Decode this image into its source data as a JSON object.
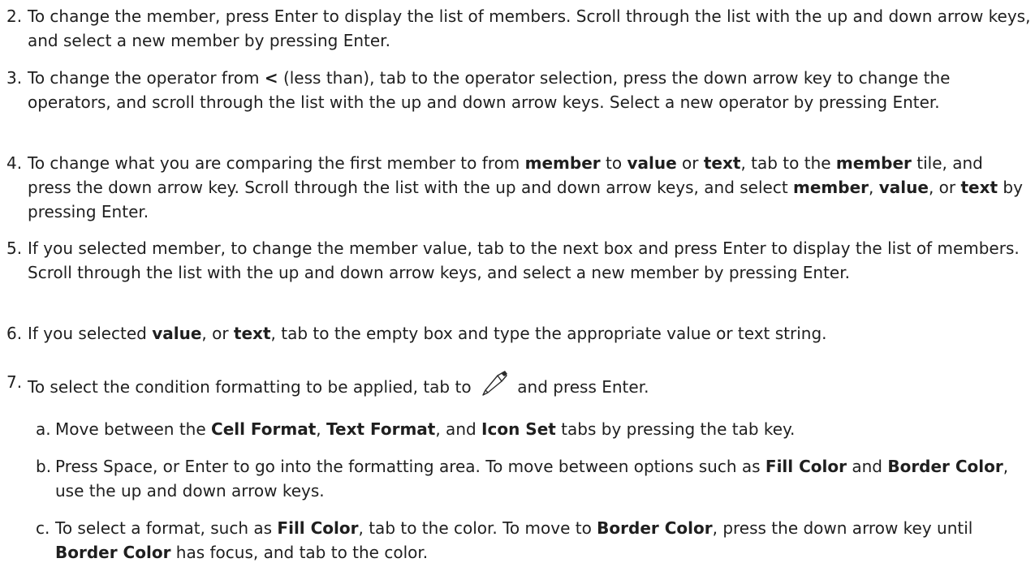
{
  "steps": [
    {
      "num": "2.",
      "segments": [
        {
          "t": "To change the member, press Enter to display the list of members. Scroll through the list with the up and down arrow keys, and select a new member by pressing Enter.",
          "b": false
        }
      ]
    },
    {
      "num": "3.",
      "segments": [
        {
          "t": "To change the operator from ",
          "b": false
        },
        {
          "t": "<",
          "b": true
        },
        {
          "t": " (less than), tab to the operator selection, press the down arrow key to change the operators, and scroll through the list with the up and down arrow keys. Select a new operator by pressing Enter.",
          "b": false
        }
      ]
    },
    {
      "num": "4.",
      "segments": [
        {
          "t": "To change what you are comparing the first member to from ",
          "b": false
        },
        {
          "t": "member",
          "b": true
        },
        {
          "t": " to ",
          "b": false
        },
        {
          "t": "value",
          "b": true
        },
        {
          "t": " or ",
          "b": false
        },
        {
          "t": "text",
          "b": true
        },
        {
          "t": ", tab to the ",
          "b": false
        },
        {
          "t": "member",
          "b": true
        },
        {
          "t": " tile, and press the down arrow key. Scroll through the list with the up and down arrow keys, and select ",
          "b": false
        },
        {
          "t": "member",
          "b": true
        },
        {
          "t": ", ",
          "b": false
        },
        {
          "t": "value",
          "b": true
        },
        {
          "t": ", or ",
          "b": false
        },
        {
          "t": "text",
          "b": true
        },
        {
          "t": " by pressing Enter.",
          "b": false
        }
      ]
    },
    {
      "num": "5.",
      "segments": [
        {
          "t": "If you selected member, to change the member value, tab to the next box and press Enter to display the list of members. Scroll through the list with the up and down arrow keys, and select a new member by pressing Enter.",
          "b": false
        }
      ]
    },
    {
      "num": "6.",
      "segments": [
        {
          "t": "If you selected ",
          "b": false
        },
        {
          "t": "value",
          "b": true
        },
        {
          "t": ", or ",
          "b": false
        },
        {
          "t": "text",
          "b": true
        },
        {
          "t": ", tab to the empty box and type the appropriate value or text string.",
          "b": false
        }
      ]
    },
    {
      "num": "7.",
      "segments": [
        {
          "t": "To select the condition formatting to be applied, tab to ",
          "b": false
        },
        {
          "icon": "pencil-icon"
        },
        {
          "t": " and press Enter.",
          "b": false
        }
      ]
    }
  ],
  "substeps": [
    {
      "num": "a.",
      "segments": [
        {
          "t": "Move between the ",
          "b": false
        },
        {
          "t": "Cell Format",
          "b": true
        },
        {
          "t": ", ",
          "b": false
        },
        {
          "t": "Text Format",
          "b": true
        },
        {
          "t": ", and ",
          "b": false
        },
        {
          "t": "Icon Set",
          "b": true
        },
        {
          "t": " tabs by pressing the tab key.",
          "b": false
        }
      ]
    },
    {
      "num": "b.",
      "segments": [
        {
          "t": "Press Space, or Enter to go into the formatting area. To move between options such as ",
          "b": false
        },
        {
          "t": "Fill Color",
          "b": true
        },
        {
          "t": " and ",
          "b": false
        },
        {
          "t": "Border Color",
          "b": true
        },
        {
          "t": ", use the up and down arrow keys.",
          "b": false
        }
      ]
    },
    {
      "num": "c.",
      "segments": [
        {
          "t": "To select a format, such as ",
          "b": false
        },
        {
          "t": "Fill Color",
          "b": true
        },
        {
          "t": ", tab to the color. To move to ",
          "b": false
        },
        {
          "t": "Border Color",
          "b": true
        },
        {
          "t": ", press the down arrow key until ",
          "b": false
        },
        {
          "t": "Border Color",
          "b": true
        },
        {
          "t": " has focus, and tab to the color.",
          "b": false
        }
      ]
    }
  ]
}
